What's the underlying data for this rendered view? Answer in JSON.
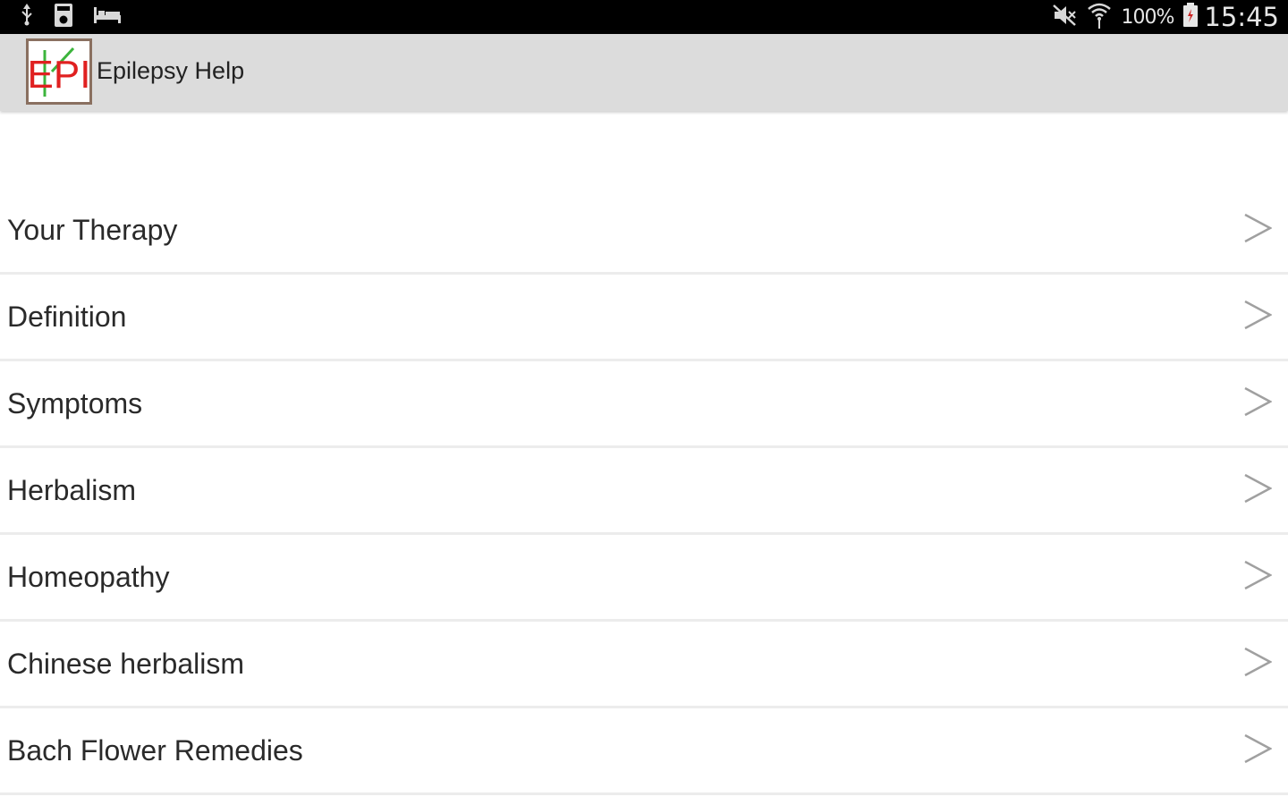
{
  "status_bar": {
    "battery_percent": "100%",
    "time": "15:45",
    "left_icons": [
      "usb-icon",
      "sim-storage-icon",
      "sleep-bed-icon"
    ],
    "right_icons": [
      "mute-icon",
      "wifi-icon",
      "battery-icon"
    ]
  },
  "action_bar": {
    "title": "Epilepsy Help",
    "logo_text": "EPI",
    "colors": {
      "background": "#dcdcdc",
      "logo_text": "#e02020",
      "logo_accent": "#3cb43c",
      "logo_border": "#8a7060"
    }
  },
  "menu": {
    "items": [
      {
        "label": "Your Therapy"
      },
      {
        "label": "Definition"
      },
      {
        "label": "Symptoms"
      },
      {
        "label": "Herbalism"
      },
      {
        "label": "Homeopathy"
      },
      {
        "label": "Chinese herbalism"
      },
      {
        "label": "Bach Flower Remedies"
      }
    ],
    "chevron_icon": "chevron-right-icon"
  }
}
